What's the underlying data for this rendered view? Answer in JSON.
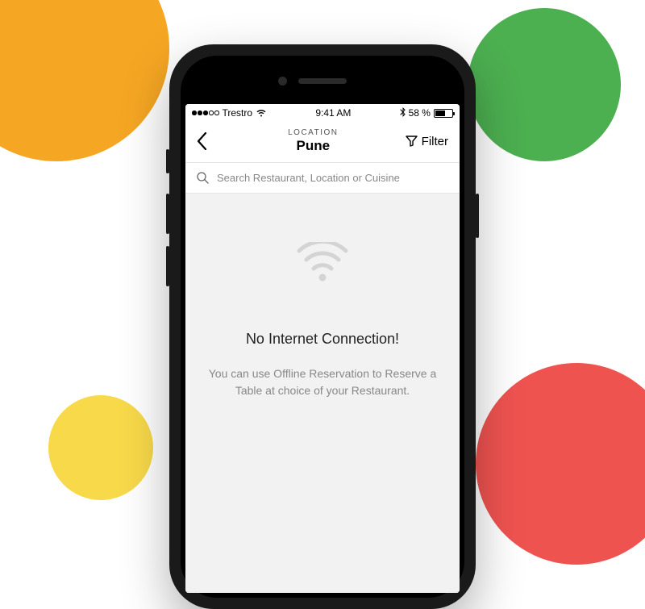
{
  "status_bar": {
    "carrier": "Trestro",
    "time": "9:41 AM",
    "battery_pct": "58 %"
  },
  "header": {
    "label": "LOCATION",
    "title": "Pune",
    "filter_label": "Filter"
  },
  "search": {
    "placeholder": "Search Restaurant, Location or Cuisine"
  },
  "empty_state": {
    "title": "No Internet Connection!",
    "message": "You can use Offline Reservation to Reserve a Table at choice of your Restaurant."
  }
}
